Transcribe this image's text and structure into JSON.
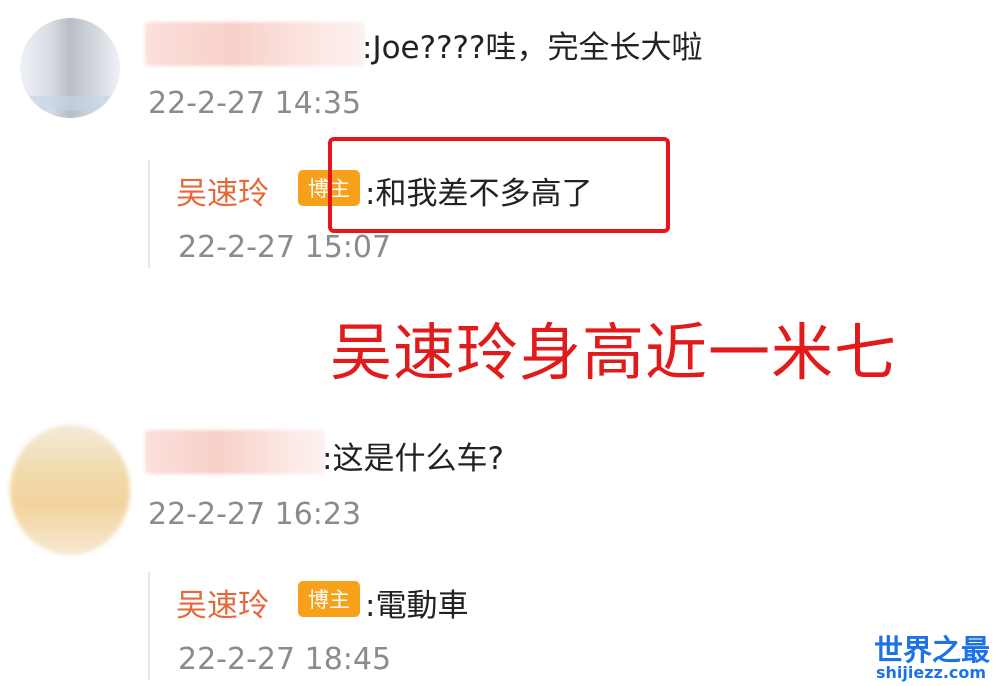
{
  "comments": [
    {
      "text": ":Joe????哇，完全长大啦",
      "timestamp": "22-2-27 14:35",
      "reply": {
        "username": "吴速玲",
        "badge": "博主",
        "text": ":和我差不多高了",
        "timestamp": "22-2-27 15:07"
      }
    },
    {
      "text": ":这是什么车?",
      "timestamp": "22-2-27 16:23",
      "reply": {
        "username": "吴速玲",
        "badge": "博主",
        "text": ":電動車",
        "timestamp": "22-2-27 18:45"
      }
    }
  ],
  "annotation": "吴速玲身高近一米七",
  "watermark": {
    "title": "世界之最",
    "url": "shijiezz.com"
  },
  "colors": {
    "username": "#e8673a",
    "badge": "#f7a11a",
    "annotation": "#e11b1b",
    "watermark": "#1d72e8"
  }
}
